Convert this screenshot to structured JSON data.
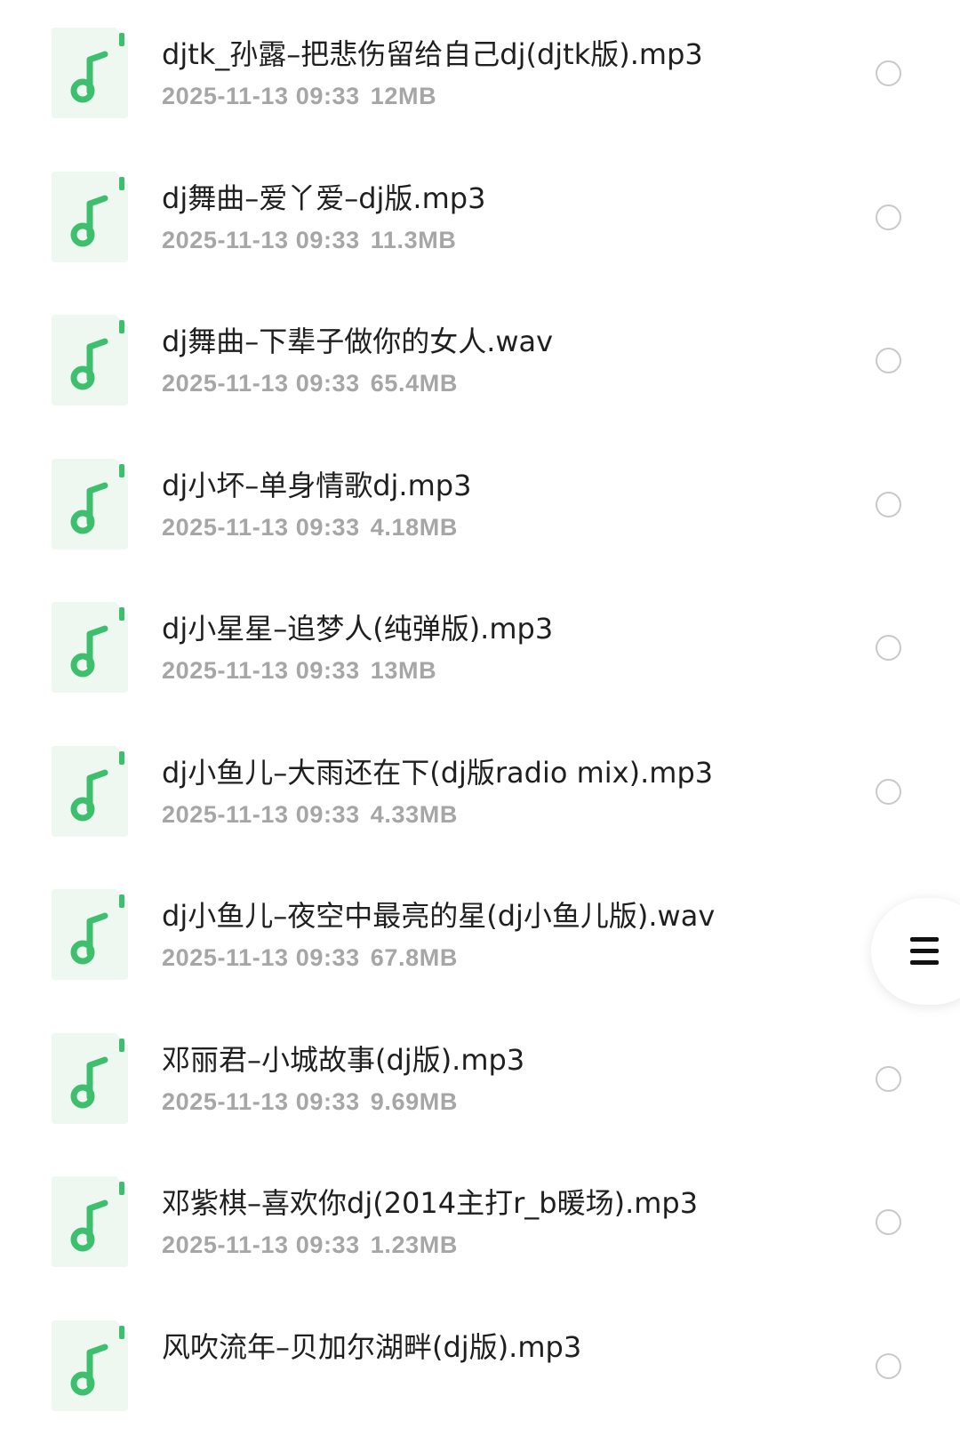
{
  "colors": {
    "icon_bg": "#eef8f1",
    "icon_accent": "#3dbf6e",
    "title_text": "#1f1f1f",
    "meta_text": "#a6a6a6",
    "radio_border": "#c9c9c9"
  },
  "icons": {
    "file": "music-file-icon",
    "select": "radio-unchecked-icon",
    "menu": "hamburger-menu-icon"
  },
  "files": [
    {
      "name": "djtk_孙露–把悲伤留给自己dj(djtk版).mp3",
      "date": "2025-11-13 09:33",
      "size": "12MB"
    },
    {
      "name": "dj舞曲–爱丫爱–dj版.mp3",
      "date": "2025-11-13 09:33",
      "size": "11.3MB"
    },
    {
      "name": "dj舞曲–下辈子做你的女人.wav",
      "date": "2025-11-13 09:33",
      "size": "65.4MB"
    },
    {
      "name": "dj小坏–单身情歌dj.mp3",
      "date": "2025-11-13 09:33",
      "size": "4.18MB"
    },
    {
      "name": "dj小星星–追梦人(纯弹版).mp3",
      "date": "2025-11-13 09:33",
      "size": "13MB"
    },
    {
      "name": "dj小鱼儿–大雨还在下(dj版radio mix).mp3",
      "date": "2025-11-13 09:33",
      "size": "4.33MB"
    },
    {
      "name": "dj小鱼儿–夜空中最亮的星(dj小鱼儿版).wav",
      "date": "2025-11-13 09:33",
      "size": "67.8MB"
    },
    {
      "name": "邓丽君–小城故事(dj版).mp3",
      "date": "2025-11-13 09:33",
      "size": "9.69MB"
    },
    {
      "name": "邓紫棋–喜欢你dj(2014主打r_b暖场).mp3",
      "date": "2025-11-13 09:33",
      "size": "1.23MB"
    },
    {
      "name": "风吹流年–贝加尔湖畔(dj版).mp3",
      "date": "",
      "size": ""
    }
  ]
}
